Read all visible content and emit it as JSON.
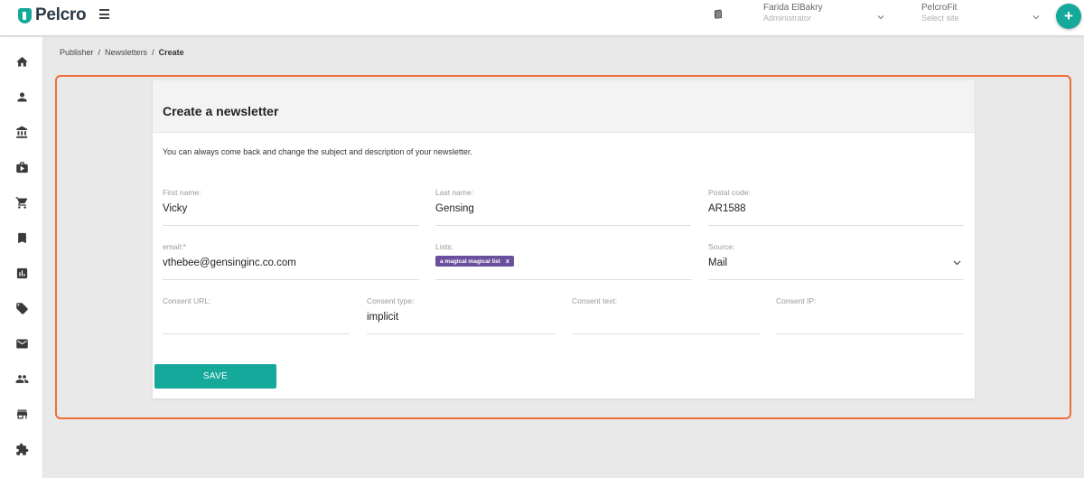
{
  "header": {
    "logo_text": "Pelcro",
    "user": {
      "name": "Farida ElBakry",
      "role": "Administrator"
    },
    "site": {
      "name": "PelcroFit",
      "placeholder": "Select site"
    },
    "add_label": "+"
  },
  "breadcrumb": [
    {
      "label": "Publisher"
    },
    {
      "label": "Newsletters"
    },
    {
      "label": "Create"
    }
  ],
  "breadcrumb_separator": "/",
  "sidebar": {
    "items": [
      {
        "icon": "home-icon"
      },
      {
        "icon": "person-icon"
      },
      {
        "icon": "bank-icon"
      },
      {
        "icon": "briefcase-play-icon"
      },
      {
        "icon": "cart-icon"
      },
      {
        "icon": "bookmark-icon"
      },
      {
        "icon": "bar-chart-icon"
      },
      {
        "icon": "tag-icon"
      },
      {
        "icon": "mail-icon"
      },
      {
        "icon": "people-icon"
      },
      {
        "icon": "store-icon"
      },
      {
        "icon": "puzzle-icon"
      }
    ]
  },
  "form": {
    "title": "Create a newsletter",
    "description": "You can always come back and change the subject and description of your newsletter.",
    "first_name": {
      "label": "First name:",
      "value": "Vicky"
    },
    "last_name": {
      "label": "Last name:",
      "value": "Gensing"
    },
    "postal_code": {
      "label": "Postal code:",
      "value": "AR1588"
    },
    "email": {
      "label": "email:*",
      "value": "vthebee@gensinginc.co.com"
    },
    "lists": {
      "label": "Lists:",
      "chip": "a magical magical list",
      "chip_remove": "x"
    },
    "source": {
      "label": "Source:",
      "value": "Mail"
    },
    "consent_url": {
      "label": "Consent URL:",
      "value": ""
    },
    "consent_type": {
      "label": "Consent type:",
      "value": "implicit"
    },
    "consent_text": {
      "label": "Consent text:",
      "value": ""
    },
    "consent_ip": {
      "label": "Consent IP:",
      "value": ""
    },
    "save_label": "SAVE"
  },
  "colors": {
    "accent": "#14a99a",
    "highlight": "#ef6d3b",
    "chip": "#6a4f9c"
  }
}
